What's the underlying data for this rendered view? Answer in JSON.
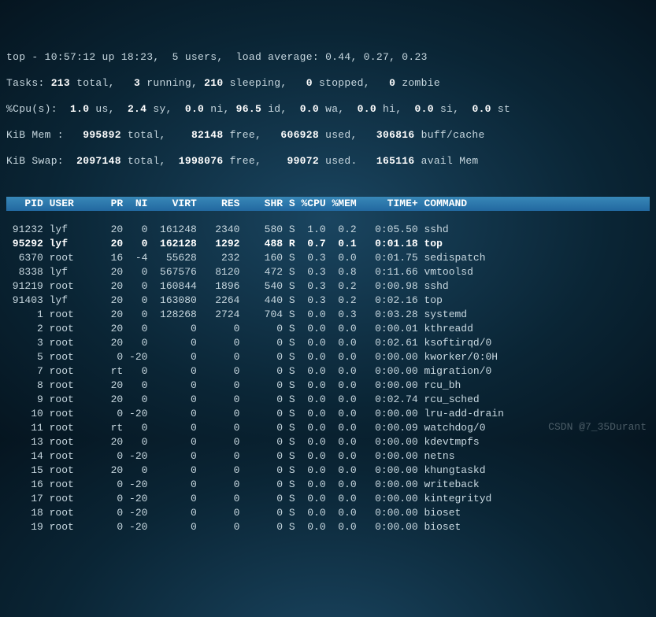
{
  "summary": {
    "line1_a": "top - 10:57:12 up 18:23,  5 users,  load average: 0.44, 0.27, 0.23",
    "line2_a": "Tasks:",
    "line2_b": " 213 ",
    "line2_c": "total,   ",
    "line2_d": "3 ",
    "line2_e": "running, ",
    "line2_f": "210 ",
    "line2_g": "sleeping,   ",
    "line2_h": "0 ",
    "line2_i": "stopped,   ",
    "line2_j": "0 ",
    "line2_k": "zombie",
    "line3_a": "%Cpu(s):  ",
    "line3_b": "1.0 ",
    "line3_c": "us,  ",
    "line3_d": "2.4 ",
    "line3_e": "sy,  ",
    "line3_f": "0.0 ",
    "line3_g": "ni, ",
    "line3_h": "96.5 ",
    "line3_i": "id,  ",
    "line3_j": "0.0 ",
    "line3_k": "wa,  ",
    "line3_l": "0.0 ",
    "line3_m": "hi,  ",
    "line3_n": "0.0 ",
    "line3_o": "si,  ",
    "line3_p": "0.0 ",
    "line3_q": "st",
    "line4_a": "KiB Mem :   ",
    "line4_b": "995892 ",
    "line4_c": "total,    ",
    "line4_d": "82148 ",
    "line4_e": "free,   ",
    "line4_f": "606928 ",
    "line4_g": "used,   ",
    "line4_h": "306816 ",
    "line4_i": "buff/cache",
    "line5_a": "KiB Swap:  ",
    "line5_b": "2097148 ",
    "line5_c": "total,  ",
    "line5_d": "1998076 ",
    "line5_e": "free,    ",
    "line5_f": "99072 ",
    "line5_g": "used.   ",
    "line5_h": "165116 ",
    "line5_i": "avail Mem"
  },
  "header": "   PID USER      PR  NI    VIRT    RES    SHR S %CPU %MEM     TIME+ COMMAND    ",
  "rows": [
    " 91232 lyf       20   0  161248   2340    580 S  1.0  0.2   0:05.50 sshd",
    " 95292 lyf       20   0  162128   1292    488 R  0.7  0.1   0:01.18 top",
    "  6370 root      16  -4   55628    232    160 S  0.3  0.0   0:01.75 sedispatch",
    "  8338 lyf       20   0  567576   8120    472 S  0.3  0.8   0:11.66 vmtoolsd",
    " 91219 root      20   0  160844   1896    540 S  0.3  0.2   0:00.98 sshd",
    " 91403 lyf       20   0  163080   2264    440 S  0.3  0.2   0:02.16 top",
    "     1 root      20   0  128268   2724    704 S  0.0  0.3   0:03.28 systemd",
    "     2 root      20   0       0      0      0 S  0.0  0.0   0:00.01 kthreadd",
    "     3 root      20   0       0      0      0 S  0.0  0.0   0:02.61 ksoftirqd/0",
    "     5 root       0 -20       0      0      0 S  0.0  0.0   0:00.00 kworker/0:0H",
    "     7 root      rt   0       0      0      0 S  0.0  0.0   0:00.00 migration/0",
    "     8 root      20   0       0      0      0 S  0.0  0.0   0:00.00 rcu_bh",
    "     9 root      20   0       0      0      0 S  0.0  0.0   0:02.74 rcu_sched",
    "    10 root       0 -20       0      0      0 S  0.0  0.0   0:00.00 lru-add-drain",
    "    11 root      rt   0       0      0      0 S  0.0  0.0   0:00.09 watchdog/0",
    "    13 root      20   0       0      0      0 S  0.0  0.0   0:00.00 kdevtmpfs",
    "    14 root       0 -20       0      0      0 S  0.0  0.0   0:00.00 netns",
    "    15 root      20   0       0      0      0 S  0.0  0.0   0:00.00 khungtaskd",
    "    16 root       0 -20       0      0      0 S  0.0  0.0   0:00.00 writeback",
    "    17 root       0 -20       0      0      0 S  0.0  0.0   0:00.00 kintegrityd",
    "    18 root       0 -20       0      0      0 S  0.0  0.0   0:00.00 bioset",
    "    19 root       0 -20       0      0      0 S  0.0  0.0   0:00.00 bioset"
  ],
  "highlight_index": 1,
  "watermark": "CSDN @7_35Durant"
}
